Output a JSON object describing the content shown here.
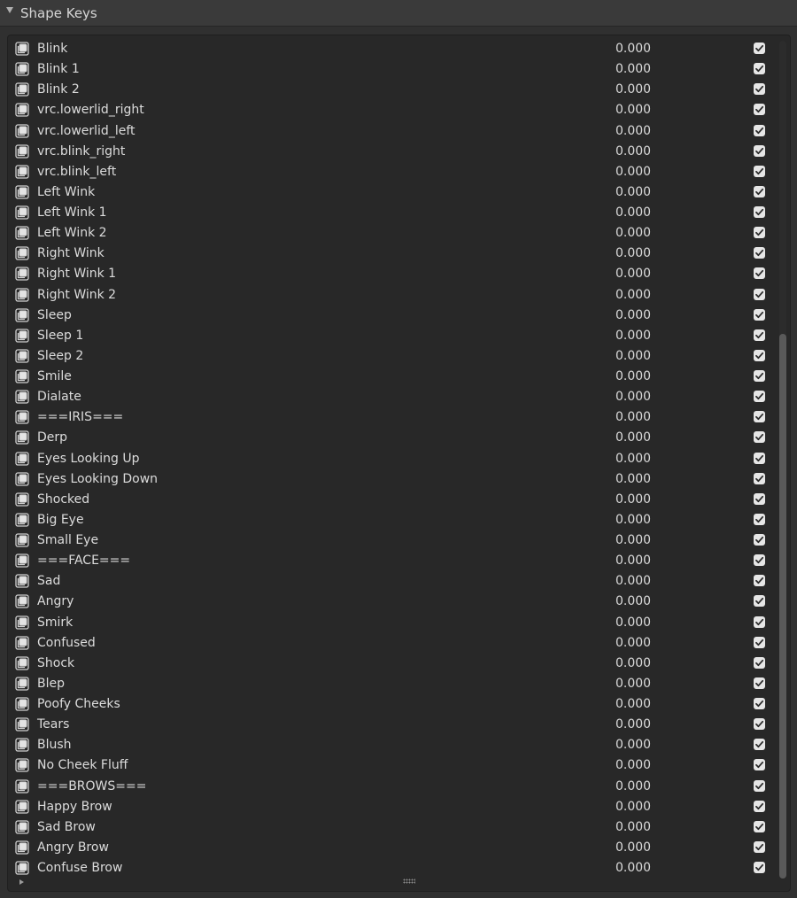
{
  "panel": {
    "title": "Shape Keys",
    "expanded": true
  },
  "icons": {
    "row_icon": "shape-key-icon",
    "checkbox": "checkmark-icon",
    "header": "disclosure-triangle-down-icon",
    "footer": "expand-triangle-right-icon",
    "grip": "resize-grip-icon"
  },
  "colors": {
    "panel_bg": "#303030",
    "list_bg": "#282828",
    "text": "#dcdcdc",
    "checkbox_fill": "#e6e6e6"
  },
  "shape_keys": [
    {
      "name": "Blink",
      "value": "0.000",
      "enabled": true
    },
    {
      "name": "Blink 1",
      "value": "0.000",
      "enabled": true
    },
    {
      "name": "Blink 2",
      "value": "0.000",
      "enabled": true
    },
    {
      "name": "vrc.lowerlid_right",
      "value": "0.000",
      "enabled": true
    },
    {
      "name": "vrc.lowerlid_left",
      "value": "0.000",
      "enabled": true
    },
    {
      "name": "vrc.blink_right",
      "value": "0.000",
      "enabled": true
    },
    {
      "name": "vrc.blink_left",
      "value": "0.000",
      "enabled": true
    },
    {
      "name": "Left Wink",
      "value": "0.000",
      "enabled": true
    },
    {
      "name": "Left Wink 1",
      "value": "0.000",
      "enabled": true
    },
    {
      "name": "Left Wink 2",
      "value": "0.000",
      "enabled": true
    },
    {
      "name": "Right Wink",
      "value": "0.000",
      "enabled": true
    },
    {
      "name": "Right Wink 1",
      "value": "0.000",
      "enabled": true
    },
    {
      "name": "Right Wink 2",
      "value": "0.000",
      "enabled": true
    },
    {
      "name": "Sleep",
      "value": "0.000",
      "enabled": true
    },
    {
      "name": "Sleep 1",
      "value": "0.000",
      "enabled": true
    },
    {
      "name": "Sleep 2",
      "value": "0.000",
      "enabled": true
    },
    {
      "name": "Smile",
      "value": "0.000",
      "enabled": true
    },
    {
      "name": "Dialate",
      "value": "0.000",
      "enabled": true
    },
    {
      "name": "===IRIS===",
      "value": "0.000",
      "enabled": true
    },
    {
      "name": "Derp",
      "value": "0.000",
      "enabled": true
    },
    {
      "name": "Eyes Looking Up",
      "value": "0.000",
      "enabled": true
    },
    {
      "name": "Eyes Looking Down",
      "value": "0.000",
      "enabled": true
    },
    {
      "name": "Shocked",
      "value": "0.000",
      "enabled": true
    },
    {
      "name": "Big Eye",
      "value": "0.000",
      "enabled": true
    },
    {
      "name": "Small Eye",
      "value": "0.000",
      "enabled": true
    },
    {
      "name": "===FACE===",
      "value": "0.000",
      "enabled": true
    },
    {
      "name": "Sad",
      "value": "0.000",
      "enabled": true
    },
    {
      "name": "Angry",
      "value": "0.000",
      "enabled": true
    },
    {
      "name": "Smirk",
      "value": "0.000",
      "enabled": true
    },
    {
      "name": "Confused",
      "value": "0.000",
      "enabled": true
    },
    {
      "name": "Shock",
      "value": "0.000",
      "enabled": true
    },
    {
      "name": "Blep",
      "value": "0.000",
      "enabled": true
    },
    {
      "name": "Poofy Cheeks",
      "value": "0.000",
      "enabled": true
    },
    {
      "name": "Tears",
      "value": "0.000",
      "enabled": true
    },
    {
      "name": "Blush",
      "value": "0.000",
      "enabled": true
    },
    {
      "name": "No Cheek Fluff",
      "value": "0.000",
      "enabled": true
    },
    {
      "name": "===BROWS===",
      "value": "0.000",
      "enabled": true
    },
    {
      "name": "Happy Brow",
      "value": "0.000",
      "enabled": true
    },
    {
      "name": "Sad Brow",
      "value": "0.000",
      "enabled": true
    },
    {
      "name": "Angry Brow",
      "value": "0.000",
      "enabled": true
    },
    {
      "name": "Confuse Brow",
      "value": "0.000",
      "enabled": true
    }
  ]
}
